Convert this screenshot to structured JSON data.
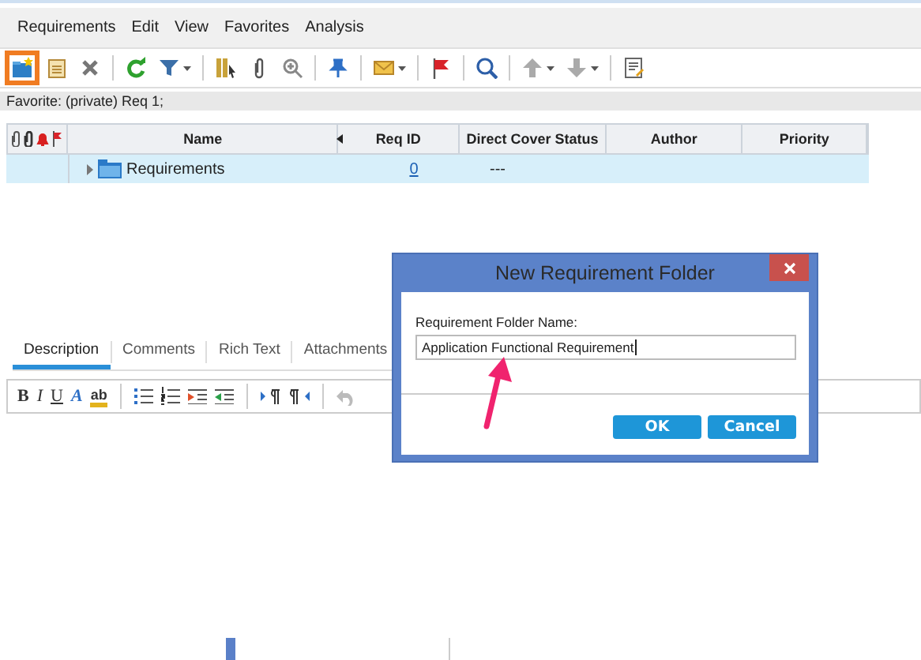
{
  "menu": [
    "Requirements",
    "Edit",
    "View",
    "Favorites",
    "Analysis"
  ],
  "toolbar": [
    [
      {
        "kind": "new-folder",
        "highlighted": true,
        "dropdown": false
      },
      {
        "kind": "new-item",
        "highlighted": false,
        "dropdown": false
      },
      {
        "kind": "delete",
        "highlighted": false,
        "dropdown": false
      }
    ],
    [
      {
        "kind": "refresh",
        "highlighted": false,
        "dropdown": false
      },
      {
        "kind": "filter",
        "highlighted": false,
        "dropdown": true
      }
    ],
    [
      {
        "kind": "columns",
        "highlighted": false,
        "dropdown": false
      },
      {
        "kind": "attach",
        "highlighted": false,
        "dropdown": false
      },
      {
        "kind": "zoom",
        "highlighted": false,
        "dropdown": false
      }
    ],
    [
      {
        "kind": "pin",
        "highlighted": false,
        "dropdown": false
      }
    ],
    [
      {
        "kind": "mail",
        "highlighted": false,
        "dropdown": true
      }
    ],
    [
      {
        "kind": "flag",
        "highlighted": false,
        "dropdown": false
      }
    ],
    [
      {
        "kind": "search",
        "highlighted": false,
        "dropdown": false
      }
    ],
    [
      {
        "kind": "up",
        "highlighted": false,
        "dropdown": true
      },
      {
        "kind": "down",
        "highlighted": false,
        "dropdown": true
      }
    ],
    [
      {
        "kind": "report",
        "highlighted": false,
        "dropdown": false
      }
    ]
  ],
  "favorite": "Favorite: (private) Req 1;",
  "grid": {
    "columns": [
      "Name",
      "Req ID",
      "Direct Cover Status",
      "Author",
      "Priority"
    ],
    "rows": [
      {
        "name": "Requirements",
        "req_id": "0",
        "direct_cover_status": "---",
        "selected": true,
        "expanded": false
      }
    ]
  },
  "tabs": [
    {
      "label": "Description",
      "selected": true
    },
    {
      "label": "Comments",
      "selected": false
    },
    {
      "label": "Rich Text",
      "selected": false
    },
    {
      "label": "Attachments",
      "selected": false
    }
  ],
  "format_buttons": [
    "B",
    "I",
    "U",
    "A",
    "ab"
  ],
  "dialog": {
    "title": "New Requirement Folder",
    "label": "Requirement Folder Name:",
    "value": "Application Functional Requirement",
    "buttons": [
      "OK",
      "Cancel"
    ]
  }
}
